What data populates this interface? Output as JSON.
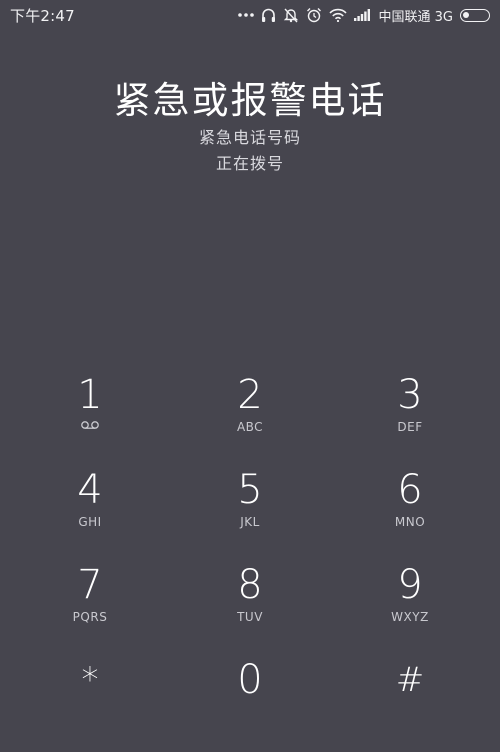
{
  "status_bar": {
    "time": "下午2:47",
    "carrier": "中国联通 3G",
    "icons": [
      "more-dots-icon",
      "headphones-icon",
      "mute-icon",
      "alarm-icon",
      "wifi-icon",
      "signal-icon",
      "battery-icon"
    ]
  },
  "call": {
    "title": "紧急或报警电话",
    "subtitle": "紧急电话号码",
    "status": "正在拨号"
  },
  "keypad": {
    "keys": [
      {
        "digit": "1",
        "letters": ""
      },
      {
        "digit": "2",
        "letters": "ABC"
      },
      {
        "digit": "3",
        "letters": "DEF"
      },
      {
        "digit": "4",
        "letters": "GHI"
      },
      {
        "digit": "5",
        "letters": "JKL"
      },
      {
        "digit": "6",
        "letters": "MNO"
      },
      {
        "digit": "7",
        "letters": "PQRS"
      },
      {
        "digit": "8",
        "letters": "TUV"
      },
      {
        "digit": "9",
        "letters": "WXYZ"
      },
      {
        "digit": "*",
        "letters": ""
      },
      {
        "digit": "0",
        "letters": ""
      },
      {
        "digit": "#",
        "letters": ""
      }
    ],
    "key_one_icon": "voicemail-icon"
  },
  "colors": {
    "background": "#46454e",
    "text": "#ffffff",
    "secondary_text": "#c9c9cf"
  }
}
